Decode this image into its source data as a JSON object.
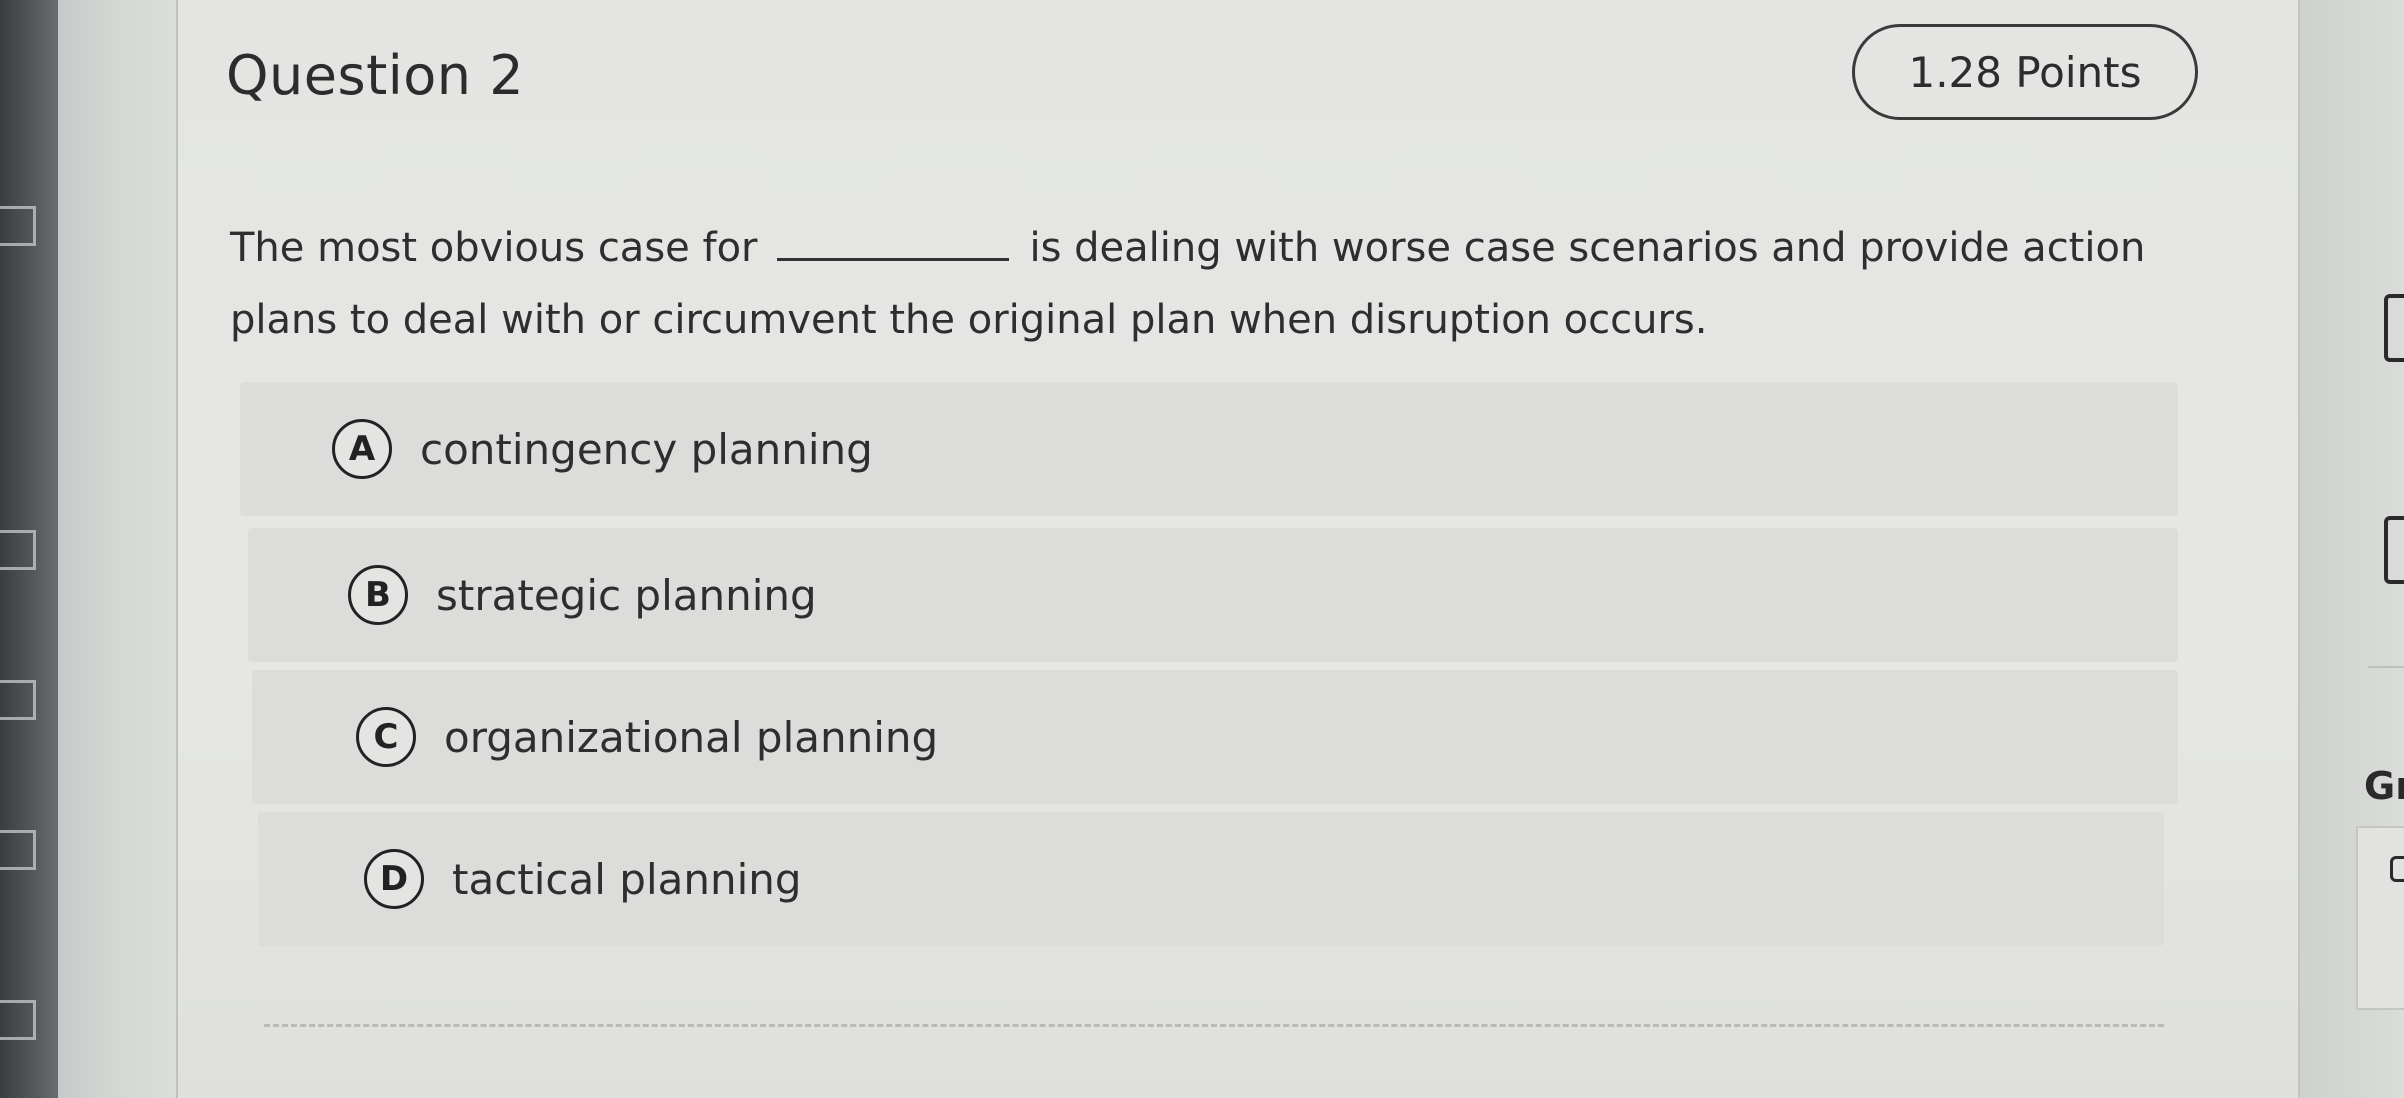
{
  "question": {
    "title": "Question 2",
    "points": "1.28 Points",
    "text_before_blank": "The most obvious case for",
    "text_after_blank": "is dealing with worse case scenarios and provide action",
    "text_line2": "plans to deal with or circumvent the original plan when disruption occurs."
  },
  "options": [
    {
      "letter": "A",
      "label": "contingency planning"
    },
    {
      "letter": "B",
      "label": "strategic planning"
    },
    {
      "letter": "C",
      "label": "organizational planning"
    },
    {
      "letter": "D",
      "label": "tactical planning"
    }
  ],
  "right_panel": {
    "partial_label": "Gı"
  },
  "colors": {
    "card_background": "#e4e5e2",
    "option_background": "#dcdddb",
    "text": "#2e2e2e"
  }
}
